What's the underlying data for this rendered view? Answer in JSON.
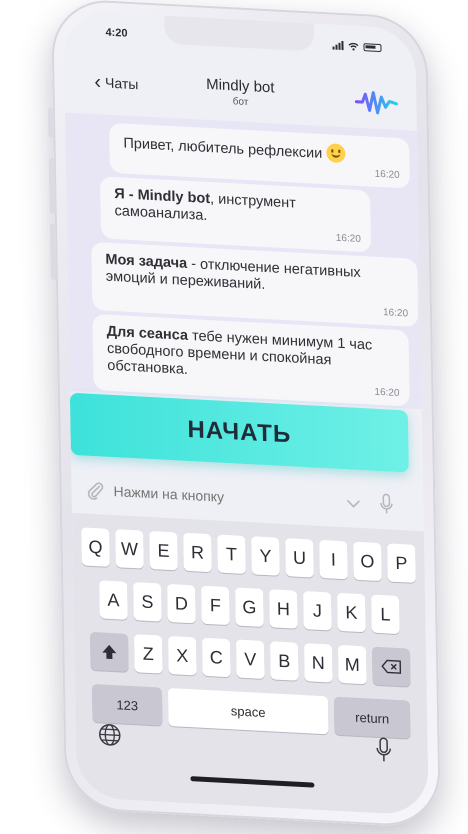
{
  "status": {
    "time": "4:20"
  },
  "nav": {
    "back_label": "Чаты",
    "title": "Mindly bot",
    "subtitle": "бот"
  },
  "messages": [
    {
      "bold": "",
      "text": "Привет, любитель рефлексии ",
      "emoji": "smiley-emoji",
      "time": "16:20"
    },
    {
      "bold": "Я - Mindly bot",
      "text": ", инструмент самоанализа.",
      "time": "16:20"
    },
    {
      "bold": "Моя задача",
      "text": " - отключение негативных эмоций и переживаний.",
      "time": "16:20"
    },
    {
      "bold": "Для сеанса",
      "text": " тебе нужен минимум 1 час свободного времени и спокойная обстановка.",
      "time": "16:20"
    }
  ],
  "start_button": {
    "label": "НАЧАТЬ"
  },
  "input": {
    "placeholder": "Нажми на кнопку"
  },
  "keyboard": {
    "row1": [
      "Q",
      "W",
      "E",
      "R",
      "T",
      "Y",
      "U",
      "I",
      "O",
      "P"
    ],
    "row2": [
      "A",
      "S",
      "D",
      "F",
      "G",
      "H",
      "J",
      "K",
      "L"
    ],
    "row3": [
      "Z",
      "X",
      "C",
      "V",
      "B",
      "N",
      "M"
    ],
    "numbers_label": "123",
    "space_label": "space",
    "return_label": "return"
  },
  "colors": {
    "accent": "#3de2da",
    "chat_bg": "#e8e6f4",
    "logo_gradient": [
      "#7b4dff",
      "#22d3e6"
    ]
  }
}
